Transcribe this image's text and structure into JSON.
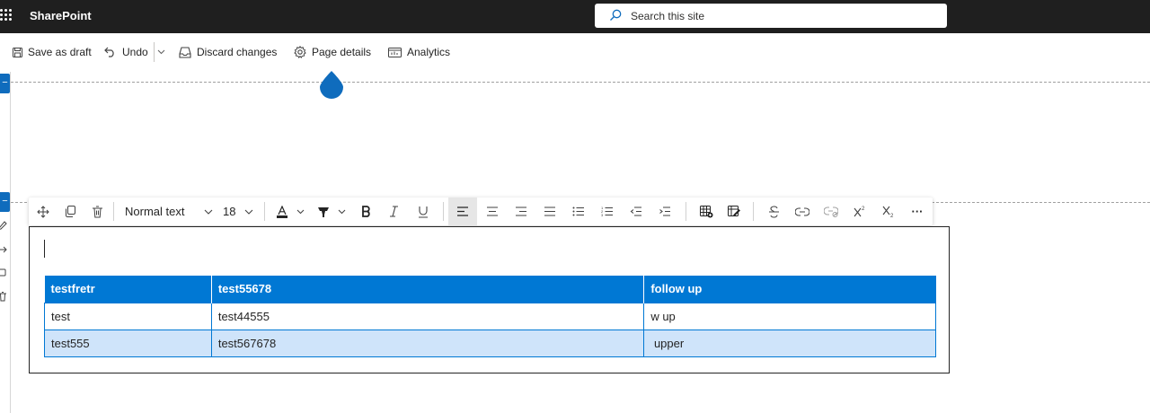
{
  "app": {
    "title": "SharePoint"
  },
  "search": {
    "placeholder": "Search this site"
  },
  "commands": {
    "save_draft": "Save as draft",
    "undo": "Undo",
    "discard": "Discard changes",
    "page_details": "Page details",
    "analytics": "Analytics"
  },
  "toolbar": {
    "style": "Normal text",
    "font_size": "18",
    "more": "···"
  },
  "table": {
    "headers": [
      "testfretr",
      "test55678",
      "follow up"
    ],
    "rows": [
      [
        "test",
        "test44555",
        "w up"
      ],
      [
        "test555",
        "test567678",
        " upper"
      ]
    ]
  },
  "colors": {
    "accent": "#0078d4",
    "alt_row": "#cfe4fa",
    "topbar": "#1f1f1f"
  },
  "icons": [
    "waffle-icon",
    "search-icon",
    "save-icon",
    "undo-icon",
    "chevron-down-icon",
    "discard-icon",
    "gear-icon",
    "analytics-icon",
    "move-icon",
    "duplicate-icon",
    "trash-icon",
    "font-color-icon",
    "highlight-icon",
    "bold-icon",
    "italic-icon",
    "underline-icon",
    "align-left-icon",
    "align-center-icon",
    "align-right-icon",
    "justify-icon",
    "bullets-icon",
    "numbering-icon",
    "indent-icon",
    "outdent-icon",
    "insert-table-icon",
    "edit-table-icon",
    "strikethrough-icon",
    "link-icon",
    "unlink-icon",
    "superscript-icon",
    "subscript-icon",
    "more-icon"
  ]
}
